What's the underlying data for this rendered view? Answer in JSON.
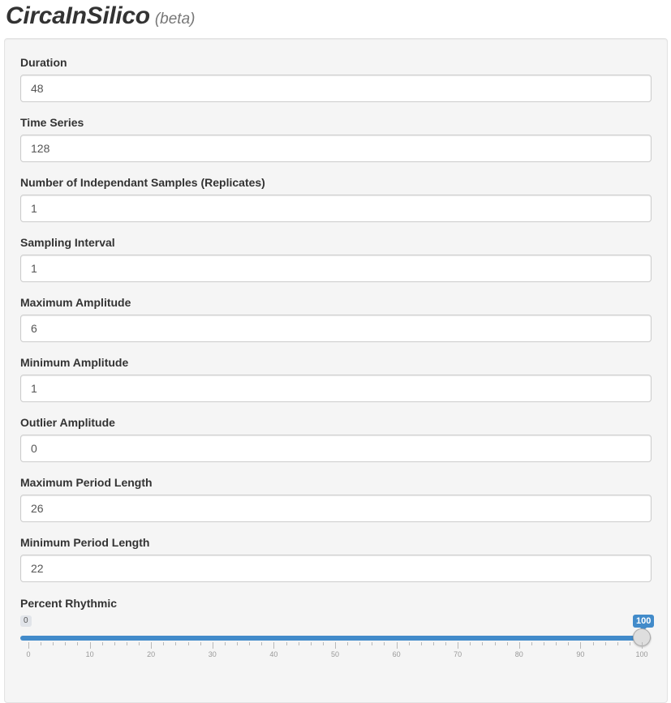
{
  "app": {
    "title": "CircaInSilico",
    "subtitle": "(beta)"
  },
  "fields": [
    {
      "label": "Duration",
      "value": "48"
    },
    {
      "label": "Time Series",
      "value": "128"
    },
    {
      "label": "Number of Independant Samples (Replicates)",
      "value": "1"
    },
    {
      "label": "Sampling Interval",
      "value": "1"
    },
    {
      "label": "Maximum Amplitude",
      "value": "6"
    },
    {
      "label": "Minimum Amplitude",
      "value": "1"
    },
    {
      "label": "Outlier Amplitude",
      "value": "0"
    },
    {
      "label": "Maximum Period Length",
      "value": "26"
    },
    {
      "label": "Minimum Period Length",
      "value": "22"
    }
  ],
  "slider": {
    "label": "Percent Rhythmic",
    "min": 0,
    "max": 100,
    "value": 100,
    "min_label": "0",
    "value_label": "100",
    "tick_labels": [
      "0",
      "10",
      "20",
      "30",
      "40",
      "50",
      "60",
      "70",
      "80",
      "90",
      "100"
    ],
    "accent_color": "#428bca"
  }
}
